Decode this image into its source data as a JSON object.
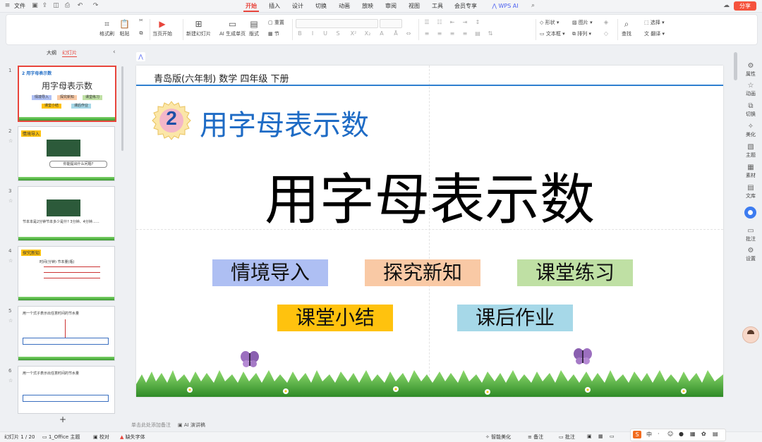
{
  "titlebar": {
    "file_label": "文件",
    "menu_tabs": [
      "开始",
      "插入",
      "设计",
      "切换",
      "动画",
      "放映",
      "审阅",
      "视图",
      "工具",
      "会员专享"
    ],
    "active_tab": "开始",
    "wps_ai_label": "WPS AI",
    "share_label": "分享"
  },
  "ribbon": {
    "format_painter": "格式刷",
    "paste": "粘贴",
    "play_from_current": "当页开始",
    "new_slide": "新建幻灯片",
    "ai_single_page": "AI 生成单页",
    "layout": "版式",
    "reset": "重置",
    "section": "节",
    "shape": "形状",
    "picture": "图片",
    "select": "选择",
    "textbox": "文本框",
    "arrange": "排列",
    "find": "查找",
    "translate": "翻译"
  },
  "sidepanel": {
    "tab_outline": "大纲",
    "tab_slides": "幻灯片",
    "add_slide_icon": "+",
    "thumbnails": [
      {
        "num": "1",
        "title": "用字母表示数",
        "badge": "2 用字母表示数",
        "chips": [
          "情境导入",
          "探究新知",
          "课堂练习",
          "课堂小结",
          "课后作业"
        ]
      },
      {
        "num": "2",
        "caption": "情境导入",
        "text": "你能提出什么问题?"
      },
      {
        "num": "3",
        "caption": "",
        "text": "节本本是2分钟节本多少是什? 3分钟、4分钟……"
      },
      {
        "num": "4",
        "caption": "探究新知",
        "text": "时间(分钟)  节本量(瓶)"
      },
      {
        "num": "5",
        "caption": "",
        "text": "用一个式子表示出任意时间的节水量"
      },
      {
        "num": "6",
        "caption": "",
        "text": "用一个式子表示出任意时间的节水量"
      }
    ]
  },
  "slide": {
    "header": "青岛版(六年制) 数学 四年级 下册",
    "badge_number": "2",
    "subtitle": "用字母表示数",
    "title": "用字母表示数",
    "boxes": [
      {
        "label": "情境导入",
        "color": "#aebff3"
      },
      {
        "label": "探究新知",
        "color": "#f9c9a5"
      },
      {
        "label": "课堂练习",
        "color": "#bfe0a4"
      },
      {
        "label": "课堂小结",
        "color": "#ffc20e"
      },
      {
        "label": "课后作业",
        "color": "#a6d8e8"
      }
    ]
  },
  "notes": {
    "placeholder": "单击此处添加备注",
    "ai_speaker_notes": "AI 演讲稿"
  },
  "rightrail": {
    "items": [
      "属性",
      "动画",
      "切换",
      "美化",
      "主题",
      "素材",
      "文库",
      "批注",
      "设置"
    ]
  },
  "statusbar": {
    "slide_counter": "幻灯片 1 / 20",
    "theme": "1_Office 主题",
    "proofread": "校对",
    "missing_font": "缺失字体",
    "smart_beautify": "智能美化",
    "notes": "备注",
    "comments": "批注"
  },
  "colors": {
    "accent": "#e8453c",
    "slide_title_blue": "#1e6bc5",
    "share_bg": "#f5533d"
  }
}
